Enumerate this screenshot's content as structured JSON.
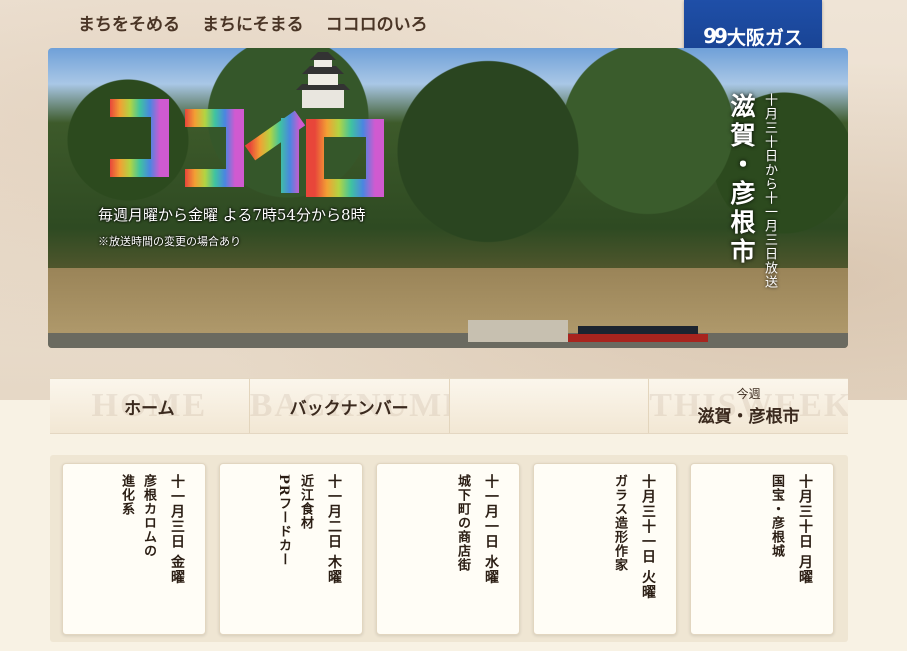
{
  "topnav": {
    "items": [
      "まちをそめる",
      "まちにそまる",
      "ココロのいろ"
    ]
  },
  "brand": {
    "logo_text": "大阪ガス",
    "logo_mark": "99",
    "color": "#1f4fa8"
  },
  "hero": {
    "program_logo": "ココイロ",
    "schedule_line1": "毎週月曜から金曜 よる7時54分から8時",
    "schedule_line2": "※放送時間の変更の場合あり",
    "city": "滋賀・彦根市",
    "broadcast_dates": "十月三十日から十一月三日放送"
  },
  "tabs": [
    {
      "label": "ホーム",
      "ghost": "HOME"
    },
    {
      "label": "バックナンバー",
      "ghost": "BACKNUMBER"
    },
    {
      "label": "",
      "ghost": ""
    },
    {
      "small": "今週",
      "label": "滋賀・彦根市",
      "ghost": "THISWEEK"
    }
  ],
  "episodes": [
    {
      "date": "十一月三日 金曜",
      "title": "彦根カロムの\n進化系"
    },
    {
      "date": "十一月二日 木曜",
      "title": "近江食材\nPRフードカー"
    },
    {
      "date": "十一月一日 水曜",
      "title": "城下町の商店街"
    },
    {
      "date": "十月三十一日 火曜",
      "title": "ガラス造形作家"
    },
    {
      "date": "十月三十日 月曜",
      "title": "国宝・彦根城"
    }
  ]
}
